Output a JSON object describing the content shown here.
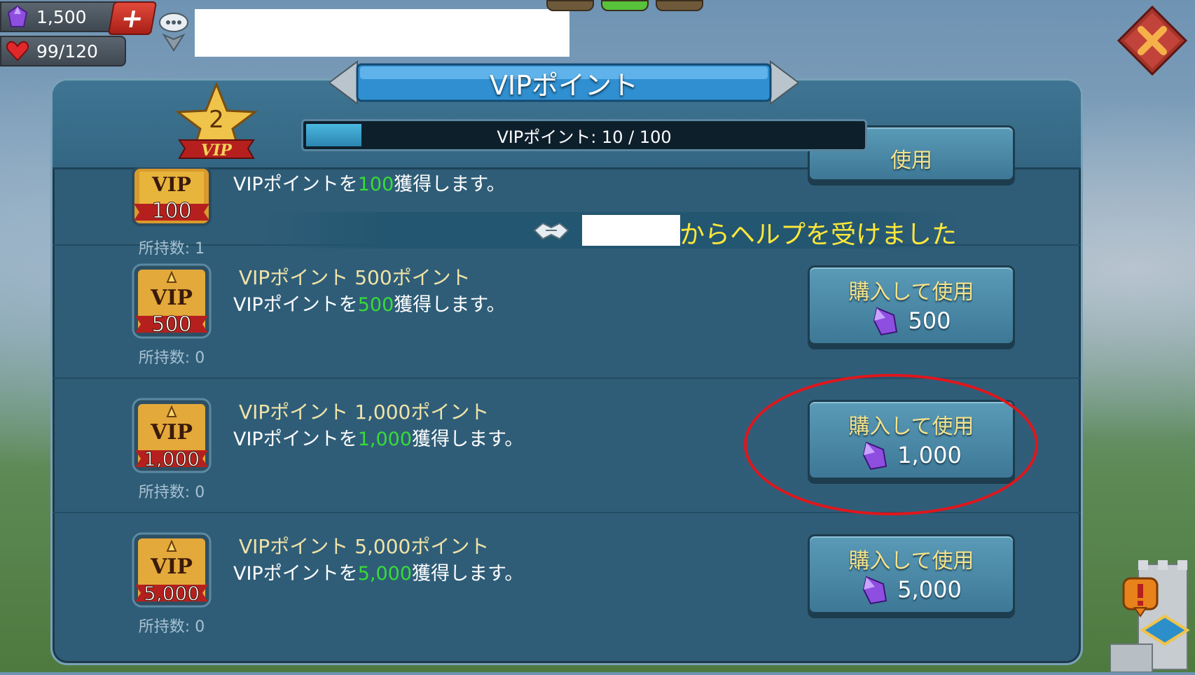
{
  "resources": {
    "gems": "1,500",
    "stamina": "99/120"
  },
  "header": {
    "title": "VIPポイント",
    "vip_level": "2",
    "vip_label": "VIP",
    "progress_text": "VIPポイント: 10 / 100",
    "progress_fraction": 0.1
  },
  "items": [
    {
      "badge_top": "VIP",
      "badge_value": "100",
      "title": "",
      "desc_prefix": "VIPポイントを",
      "desc_num": "100",
      "desc_suffix": "獲得します。",
      "owned": "所持数: 1",
      "button_label": "使用",
      "cost": ""
    },
    {
      "badge_top": "VIP",
      "badge_value": "500",
      "title": "VIPポイント 500ポイント",
      "desc_prefix": "VIPポイントを",
      "desc_num": "500",
      "desc_suffix": "獲得します。",
      "owned": "所持数: 0",
      "button_label": "購入して使用",
      "cost": "500"
    },
    {
      "badge_top": "VIP",
      "badge_value": "1,000",
      "title": "VIPポイント 1,000ポイント",
      "desc_prefix": "VIPポイントを",
      "desc_num": "1,000",
      "desc_suffix": "獲得します。",
      "owned": "所持数: 0",
      "button_label": "購入して使用",
      "cost": "1,000"
    },
    {
      "badge_top": "VIP",
      "badge_value": "5,000",
      "title": "VIPポイント 5,000ポイント",
      "desc_prefix": "VIPポイントを",
      "desc_num": "5,000",
      "desc_suffix": "獲得します。",
      "owned": "所持数: 0",
      "button_label": "購入して使用",
      "cost": "5,000"
    }
  ],
  "help_message": "からヘルプを受けました",
  "colors": {
    "gem_purple": "#8e4fe0",
    "highlight_green": "#37dc38",
    "help_yellow": "#ffe83a",
    "ring_red": "#e0161c"
  },
  "icons": [
    "gem-icon",
    "heart-icon",
    "plus-icon",
    "chat-icon",
    "close-icon",
    "vip-star-icon",
    "handshake-icon",
    "castle-icon",
    "alert-icon"
  ]
}
